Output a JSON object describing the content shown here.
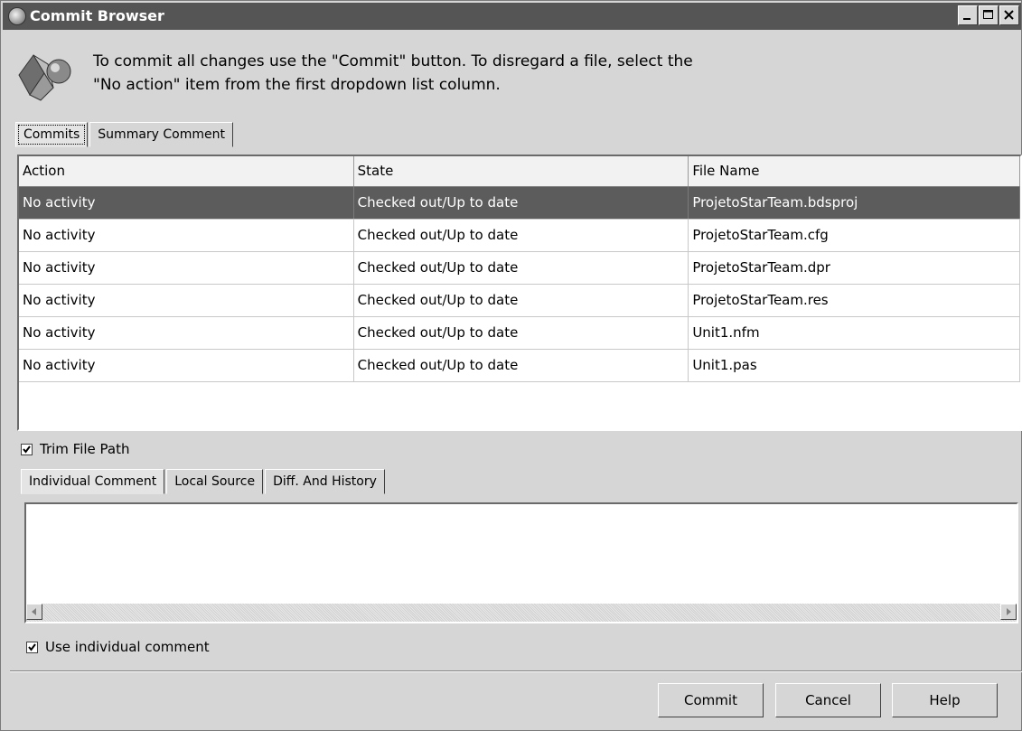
{
  "window": {
    "title": "Commit Browser"
  },
  "header": {
    "instruction_line1": "To commit all changes use the \"Commit\" button. To disregard a file, select the",
    "instruction_line2": "\"No action\" item from the first dropdown list column."
  },
  "top_tabs": [
    {
      "label": "Commits",
      "active": true
    },
    {
      "label": "Summary Comment",
      "active": false
    }
  ],
  "grid": {
    "columns": [
      "Action",
      "State",
      "File Name"
    ],
    "rows": [
      {
        "action": "No activity",
        "state": "Checked out/Up to date",
        "file": "ProjetoStarTeam.bdsproj",
        "selected": true
      },
      {
        "action": "No activity",
        "state": "Checked out/Up to date",
        "file": "ProjetoStarTeam.cfg",
        "selected": false
      },
      {
        "action": "No activity",
        "state": "Checked out/Up to date",
        "file": "ProjetoStarTeam.dpr",
        "selected": false
      },
      {
        "action": "No activity",
        "state": "Checked out/Up to date",
        "file": "ProjetoStarTeam.res",
        "selected": false
      },
      {
        "action": "No activity",
        "state": "Checked out/Up to date",
        "file": "Unit1.nfm",
        "selected": false
      },
      {
        "action": "No activity",
        "state": "Checked out/Up to date",
        "file": "Unit1.pas",
        "selected": false
      }
    ]
  },
  "trim_file_path": {
    "label": "Trim File Path",
    "checked": true
  },
  "bottom_tabs": [
    {
      "label": "Individual Comment",
      "active": true
    },
    {
      "label": "Local Source",
      "active": false
    },
    {
      "label": "Diff. And History",
      "active": false
    }
  ],
  "comment": {
    "value": ""
  },
  "use_individual_comment": {
    "label": "Use individual comment",
    "checked": true
  },
  "buttons": {
    "commit": "Commit",
    "cancel": "Cancel",
    "help": "Help"
  }
}
